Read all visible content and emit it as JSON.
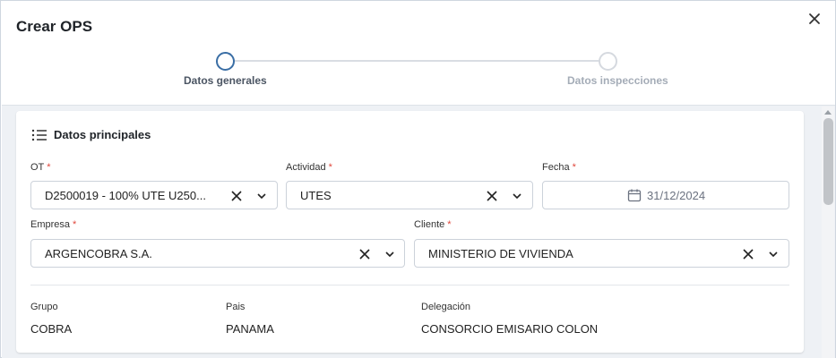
{
  "dialog": {
    "title": "Crear OPS",
    "close_icon": "close-icon"
  },
  "stepper": {
    "steps": [
      {
        "label": "Datos generales",
        "state": "active"
      },
      {
        "label": "Datos inspecciones",
        "state": "inactive"
      }
    ]
  },
  "section": {
    "title": "Datos principales",
    "icon": "list-icon"
  },
  "fields": {
    "ot": {
      "label": "OT",
      "required": "*",
      "value": "D2500019 - 100% UTE U250..."
    },
    "actividad": {
      "label": "Actividad",
      "required": "*",
      "value": "UTES"
    },
    "fecha": {
      "label": "Fecha",
      "required": "*",
      "value": "31/12/2024"
    },
    "empresa": {
      "label": "Empresa",
      "required": "*",
      "value": "ARGENCOBRA S.A."
    },
    "cliente": {
      "label": "Cliente",
      "required": "*",
      "value": "MINISTERIO DE VIVIENDA"
    }
  },
  "info": {
    "grupo": {
      "label": "Grupo",
      "value": "COBRA"
    },
    "pais": {
      "label": "Pais",
      "value": "PANAMA"
    },
    "delegacion": {
      "label": "Delegación",
      "value": "CONSORCIO EMISARIO COLON"
    }
  },
  "colors": {
    "accent": "#3a6ea5",
    "required": "#e0473c",
    "step_inactive": "#a4acb7"
  }
}
